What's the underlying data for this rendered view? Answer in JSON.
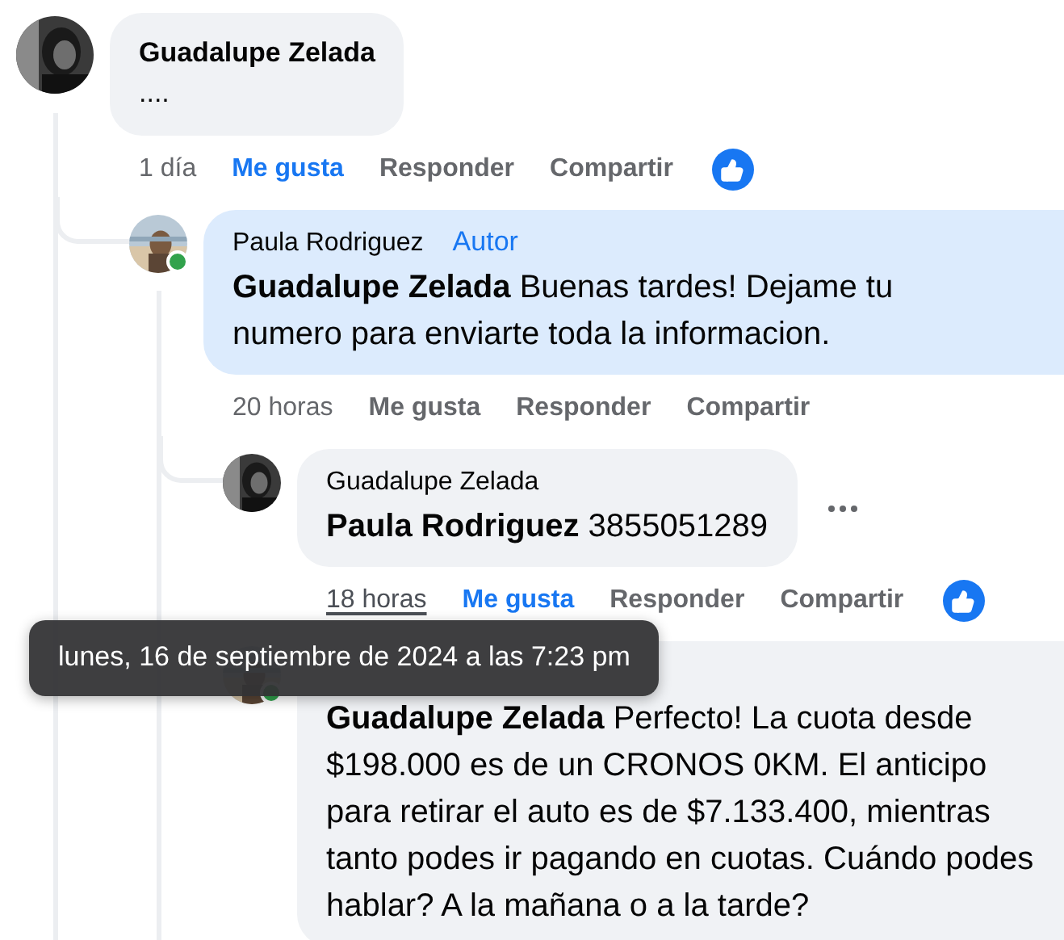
{
  "comments": [
    {
      "author": "Guadalupe Zelada",
      "text": "....",
      "time": "1 día",
      "liked": true,
      "actions": [
        "Me gusta",
        "Responder",
        "Compartir"
      ],
      "reaction": true,
      "replies": [
        {
          "author": "Paula Rodriguez",
          "badge": "Autor",
          "online": true,
          "highlighted": true,
          "mention": "Guadalupe Zelada",
          "text": "Buenas tardes! Dejame tu numero para enviarte toda la informacion.",
          "time": "20 horas",
          "liked": false,
          "actions": [
            "Me gusta",
            "Responder",
            "Compartir"
          ],
          "replies": [
            {
              "author": "Guadalupe Zelada",
              "mention": "Paula Rodriguez",
              "text": "3855051289",
              "time": "18 horas",
              "time_hovered": true,
              "liked": true,
              "actions": [
                "Me gusta",
                "Responder",
                "Compartir"
              ],
              "reaction": true,
              "more": true
            },
            {
              "online": true,
              "mention": "Guadalupe Zelada",
              "text": "Perfecto! La cuota desde $198.000 es de un CRONOS 0KM. El anticipo para retirar el auto es de $7.133.400, mientras tanto podes ir pagando en cuotas. Cuándo podes hablar? A la mañana o a la tarde?"
            }
          ]
        }
      ]
    }
  ],
  "tooltip": {
    "text": "lunes, 16 de septiembre de 2024 a las 7:23 pm"
  }
}
